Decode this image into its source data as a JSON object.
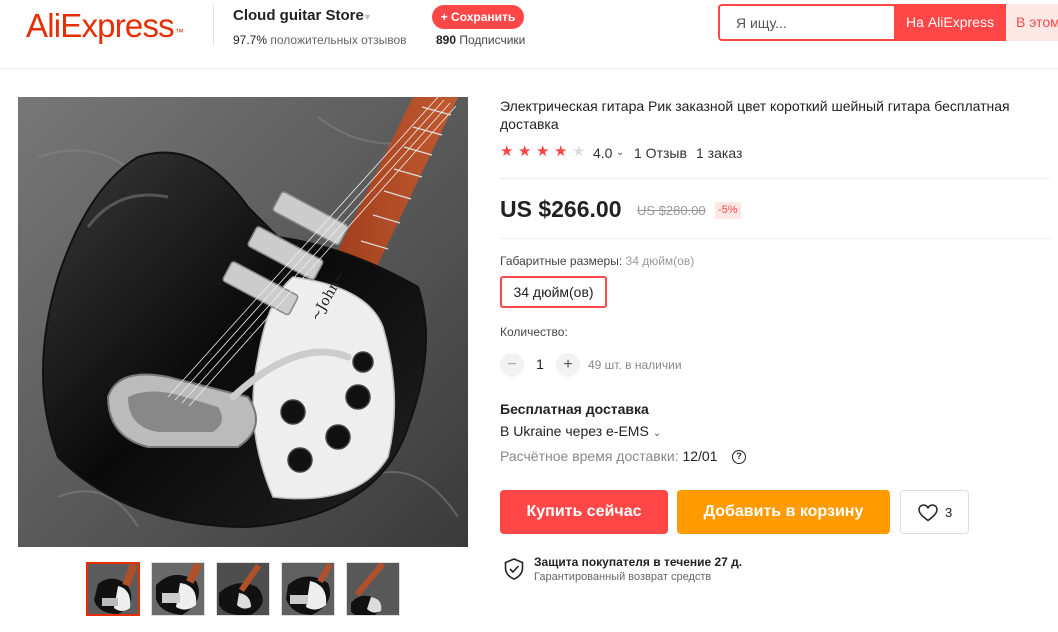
{
  "header": {
    "logo": "AliExpress",
    "logo_tm": "™",
    "store_name": "Cloud guitar Store",
    "rating_percent": "97.7%",
    "rating_text": "положительных отзывов",
    "save_button": "+ Сохранить",
    "subscribers_count": "890",
    "subscribers_label": "Подписчики"
  },
  "search": {
    "placeholder": "Я ищу...",
    "on_aliexpress": "На AliExpress",
    "in_store": "В этом"
  },
  "product": {
    "title": "Электрическая гитара Рик заказной цвет короткий шейный гитара бесплатная доставка",
    "rating_value": "4.0",
    "rating_stars": 4,
    "reviews": "1 Отзыв",
    "orders": "1 заказ",
    "price": "US $266.00",
    "old_price": "US $280.00",
    "discount": "-5%",
    "size_label": "Габаритные размеры:",
    "size_selected": "34 дюйм(ов)",
    "size_option": "34 дюйм(ов)",
    "quantity_label": "Количество:",
    "quantity": "1",
    "stock": "49 шт. в наличии"
  },
  "shipping": {
    "title": "Бесплатная доставка",
    "destination": "В Ukraine через e-EMS",
    "time_label": "Расчётное время доставки:",
    "time_value": "12/01"
  },
  "actions": {
    "buy_now": "Купить сейчас",
    "add_to_cart": "Добавить в корзину",
    "wishlist_count": "3"
  },
  "protection": {
    "title": "Защита покупателя в течение 27 д.",
    "subtitle": "Гарантированный возврат средств"
  },
  "colors": {
    "brand_red": "#ff4747",
    "logo_red": "#e62e04",
    "cart_orange": "#ff9a00"
  },
  "icons": [
    "chevron-down-icon",
    "star-icon",
    "minus-icon",
    "plus-icon",
    "help-icon",
    "heart-icon",
    "shield-check-icon"
  ]
}
